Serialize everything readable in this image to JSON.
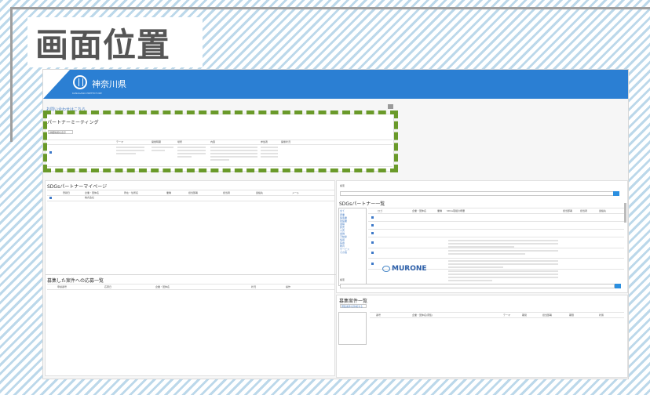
{
  "heading": "画面位置",
  "header": {
    "prefecture": "神奈川県",
    "logo_caption": "KANAGAWA PREFECTURE"
  },
  "contact_link": "お問い合わせはこちら",
  "partner_meeting": {
    "title": "パートナーミーティング",
    "button": "詳細情報を表示",
    "columns": [
      "テーマ",
      "開催時期",
      "場所",
      "内容",
      "参加者",
      "開催状況"
    ]
  },
  "my_page": {
    "title": "SDGsパートナーマイページ",
    "columns": [
      "登録日",
      "企業・団体名",
      "所在・住所名",
      "業種",
      "担当部署",
      "担当者",
      "連絡先",
      "メール"
    ],
    "row": [
      "",
      "株式会社",
      "",
      "",
      "",
      "",
      "",
      ""
    ]
  },
  "applications": {
    "title": "募集した案件への応募一覧",
    "columns": [
      "申請番号",
      "応募日",
      "企業・団体名",
      "状況",
      "操作"
    ]
  },
  "partner_list": {
    "title": "SDGsパートナー一覧",
    "search_label": "検索",
    "columns": [
      "ロゴ",
      "企業・団体名",
      "業種",
      "SDGs取組の概要",
      "担当部署",
      "担当者",
      "連絡先"
    ],
    "filters": [
      "全て",
      "農業",
      "製造業",
      "建設業",
      "運輸",
      "卸売",
      "小売",
      "金融",
      "不動産",
      "情報",
      "医療",
      "教育",
      "サービス",
      "その他"
    ],
    "brand_logo": "MURONE"
  },
  "recruitment": {
    "title": "募集案件一覧",
    "button": "募集案件を作成する",
    "columns": [
      "番号",
      "企業・団体名(募集)",
      "テーマ",
      "期間",
      "担当部署",
      "期限",
      "状態"
    ]
  },
  "colors": {
    "header": "#2b7fd3",
    "dash": "#6a9a2a",
    "stripe": "#bcd8ea"
  }
}
